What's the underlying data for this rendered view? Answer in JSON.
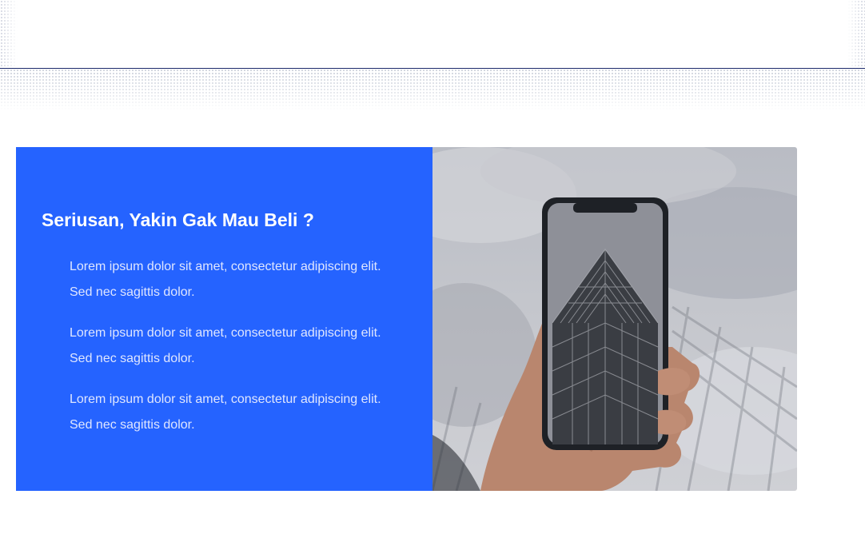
{
  "header": {
    "title": ""
  },
  "feature": {
    "heading": "Seriusan, Yakin Gak Mau Beli ?",
    "items": [
      {
        "text": "Lorem ipsum dolor sit amet, consectetur adipiscing elit. Sed nec sagittis dolor."
      },
      {
        "text": "Lorem ipsum dolor sit amet, consectetur adipiscing elit. Sed nec sagittis dolor."
      },
      {
        "text": "Lorem ipsum dolor sit amet, consectetur adipiscing elit. Sed nec sagittis dolor."
      }
    ],
    "image": {
      "icon": "hand-holding-phone-photo"
    }
  },
  "colors": {
    "panel_background": "#2563ff",
    "heading_text": "#ffffff",
    "body_text": "#dfe6ff",
    "divider": "#1d2a6b"
  }
}
